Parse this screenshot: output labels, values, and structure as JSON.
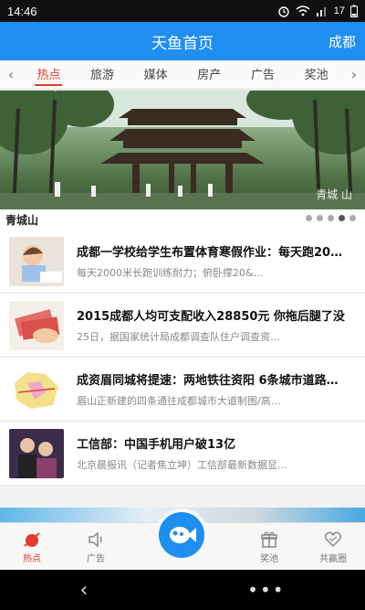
{
  "status_bar": {
    "time": "14:46",
    "battery_level": "17"
  },
  "header": {
    "title": "天鱼首页",
    "city": "成都"
  },
  "tabs": [
    {
      "label": "热点",
      "active": true
    },
    {
      "label": "旅游",
      "active": false
    },
    {
      "label": "媒体",
      "active": false
    },
    {
      "label": "房产",
      "active": false
    },
    {
      "label": "广告",
      "active": false
    },
    {
      "label": "奖池",
      "active": false
    }
  ],
  "banner": {
    "caption": "青城山",
    "overlay_text": "青城   山",
    "slide_index": 3,
    "slide_count": 5
  },
  "news": [
    {
      "title": "成都一学校给学生布置体育寒假作业：每天跑20…",
      "desc": "每天2000米长跑训练耐力；俯卧撑20&…"
    },
    {
      "title": "2015成都人均可支配收入28850元 你拖后腿了没",
      "desc": "25日，据国家统计局成都调查队住户调查资…"
    },
    {
      "title": "成资眉同城将提速：两地铁往资阳 6条城市道路…",
      "desc": "眉山正新建的四条通往成都城市大道制图/高…"
    },
    {
      "title": "工信部：中国手机用户破13亿",
      "desc": "北京晨报讯（记者焦立坤）工信部最新数据显…"
    }
  ],
  "bottom_nav": [
    {
      "label": "热点",
      "icon": "hot-icon",
      "active": true
    },
    {
      "label": "广告",
      "icon": "speaker-icon",
      "active": false
    },
    {
      "label": "奖池",
      "icon": "gift-icon",
      "active": false
    },
    {
      "label": "共赢圈",
      "icon": "heart-icon",
      "active": false
    }
  ],
  "colors": {
    "accent": "#1e8ef0",
    "active_red": "#e23b2c"
  }
}
